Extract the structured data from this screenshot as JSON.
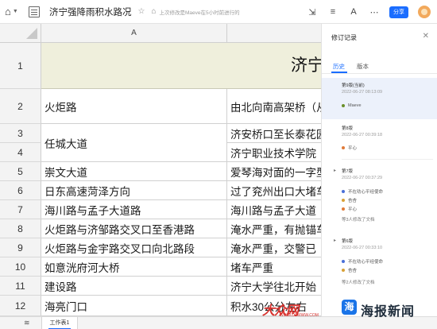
{
  "toolbar": {
    "title": "济宁强降雨积水路况",
    "save_status": "上次修改是Maeve在5小时前进行的",
    "share_label": "分享"
  },
  "sheet": {
    "column_header": "A",
    "title_row": {
      "row": "1",
      "text": "济宁"
    },
    "rows": [
      {
        "row": "2",
        "a": "火炬路",
        "b": "由北向南高架桥（从"
      },
      {
        "row": "3",
        "a": "任城大道",
        "b": "济安桥口至长泰花园"
      },
      {
        "row": "4",
        "a": "",
        "b": "济宁职业技术学院"
      },
      {
        "row": "5",
        "a": "崇文大道",
        "b": "爱琴海对面的一字型"
      },
      {
        "row": "6",
        "a": "日东高速菏泽方向",
        "b": "过了兖州出口大堵车"
      },
      {
        "row": "7",
        "a": "海川路与孟子大道路",
        "b": "海川路与孟子大道"
      },
      {
        "row": "8",
        "a": "火炬路与济邹路交叉口至香港路",
        "b": "淹水严重，有抛锚车"
      },
      {
        "row": "9",
        "a": "火炬路与金宇路交叉口向北路段",
        "b": "淹水严重，交警已"
      },
      {
        "row": "10",
        "a": "如意洸府河大桥",
        "b": "堵车严重"
      },
      {
        "row": "11",
        "a": "建设路",
        "b": "济宁大学往北开始"
      },
      {
        "row": "12",
        "a": "海亮门口",
        "b": "积水30公分左右"
      }
    ]
  },
  "bottom": {
    "sheet_tab": "工作表1"
  },
  "panel": {
    "title": "修订记录",
    "tabs": [
      "历史",
      "版本"
    ],
    "versions": [
      {
        "name": "第9版(当前)",
        "time": "2022-06-27 08:13:09",
        "users": [
          {
            "name": "Maeve",
            "color": "#6a8f2a"
          }
        ],
        "note": ""
      },
      {
        "name": "第8版",
        "time": "2022-06-27 00:39:18",
        "users": [
          {
            "name": "平心",
            "color": "#e07b39"
          }
        ],
        "note": ""
      },
      {
        "name": "第7版",
        "time": "2022-06-27 00:37:29",
        "users": [
          {
            "name": "不在劝心平经使命",
            "color": "#4a6fd8"
          },
          {
            "name": "杏杏",
            "color": "#d8a136"
          },
          {
            "name": "平心",
            "color": "#e07b39"
          }
        ],
        "note": "等3人修改了文档"
      },
      {
        "name": "第6版",
        "time": "2022-06-27 00:33:10",
        "users": [
          {
            "name": "不在劝心平经使命",
            "color": "#4a6fd8"
          },
          {
            "name": "杏杏",
            "color": "#d8a136"
          }
        ],
        "note": "等2人修改了文档"
      }
    ]
  },
  "watermarks": {
    "dazhong": "大众网",
    "dazhong_url": "WWW.DZWWW.COM",
    "haibao_icon": "海",
    "haibao": "海报新闻"
  }
}
